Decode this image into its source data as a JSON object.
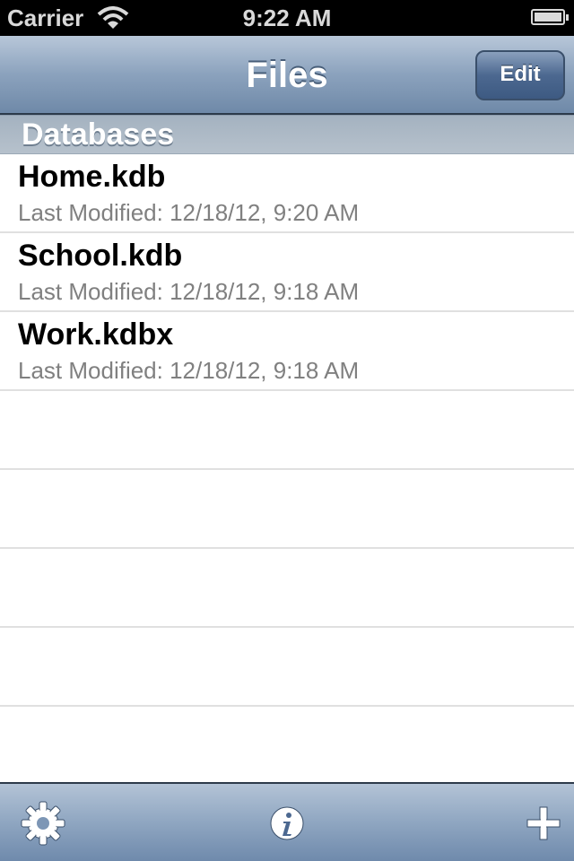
{
  "status_bar": {
    "carrier": "Carrier",
    "time": "9:22 AM",
    "icons": [
      "wifi-icon",
      "battery-icon"
    ]
  },
  "nav_bar": {
    "title": "Files",
    "edit_label": "Edit"
  },
  "section": {
    "title": "Databases"
  },
  "files": [
    {
      "name": "Home.kdb",
      "modified": "Last Modified: 12/18/12, 9:20 AM"
    },
    {
      "name": "School.kdb",
      "modified": "Last Modified: 12/18/12, 9:18 AM"
    },
    {
      "name": "Work.kdbx",
      "modified": "Last Modified: 12/18/12, 9:18 AM"
    }
  ],
  "toolbar": {
    "icons": [
      "gear-icon",
      "info-icon",
      "plus-icon"
    ]
  },
  "colors": {
    "nav_bar": "#8ba2bd",
    "section_header": "#aeb9c5",
    "subtitle_text": "#808080"
  }
}
